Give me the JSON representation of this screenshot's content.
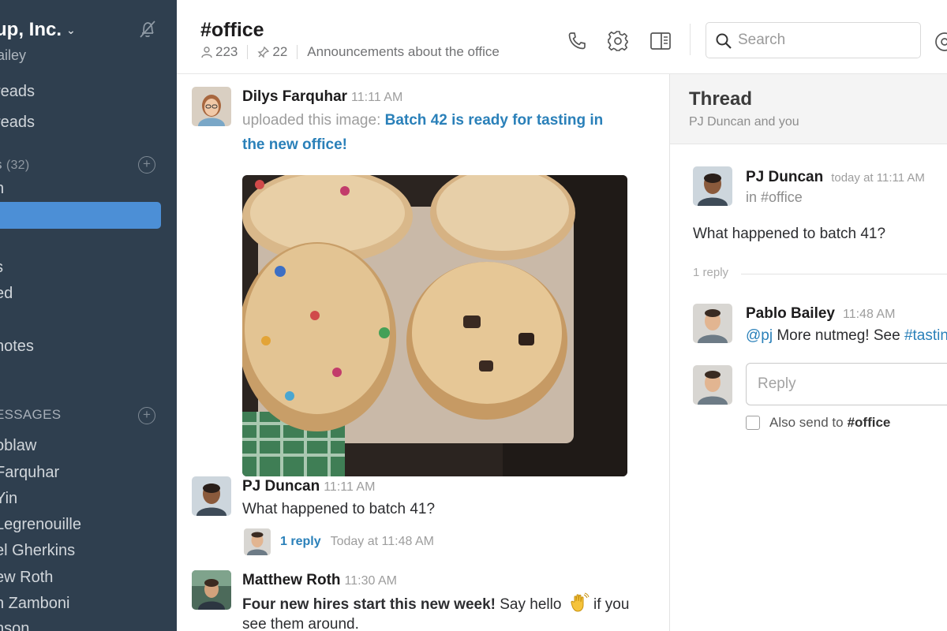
{
  "sidebar": {
    "team_name": "up, Inc.",
    "user_name": "ailey",
    "items_top": [
      "reads",
      "reads"
    ],
    "channels_header": "s",
    "channels_count": "(32)",
    "channel_items": [
      "n",
      "",
      "s",
      "ed",
      "notes"
    ],
    "dm_header": "ESSAGES",
    "dm_items": [
      "oblaw",
      "Farquhar",
      "Yin",
      "Legrenouille",
      "el Gherkins",
      "ew Roth",
      "n Zamboni",
      "nson"
    ]
  },
  "header": {
    "channel_name": "#office",
    "member_count": "223",
    "pinned_count": "22",
    "topic": "Announcements about the office",
    "search_placeholder": "Search"
  },
  "messages": [
    {
      "author": "Dilys Farquhar",
      "time": "11:11 AM",
      "prefix": "uploaded this image:",
      "link_line1": "Batch 42 is ready for tasting in",
      "link_line2": "the new office!"
    },
    {
      "author": "PJ Duncan",
      "time": "11:11 AM",
      "text": "What happened to batch 41?",
      "reply_count": "1 reply",
      "reply_time": "Today at 11:48 AM"
    },
    {
      "author": "Matthew Roth",
      "time": "11:30 AM",
      "text_line1_bold": "Four new hires start this new week!",
      "text_line1_rest": " Say hello",
      "text_line1_end": " if you",
      "text_line2": "see them around."
    }
  ],
  "thread": {
    "title": "Thread",
    "participants": "PJ Duncan and you",
    "parent": {
      "author": "PJ Duncan",
      "time": "today at 11:11 AM",
      "channel": "in #office",
      "text": "What happened to batch 41?"
    },
    "reply_count": "1 reply",
    "reply": {
      "author": "Pablo Bailey",
      "time": "11:48 AM",
      "mention": "@pj",
      "text": " More nutmeg! See ",
      "channel_link": "#tasting"
    },
    "reply_placeholder": "Reply",
    "also_send_label": "Also send to",
    "also_send_channel": "#office"
  },
  "colors": {
    "sidebar_bg": "#2f3f4f",
    "active_channel": "#4c8fd6",
    "link": "#2a80b9"
  }
}
